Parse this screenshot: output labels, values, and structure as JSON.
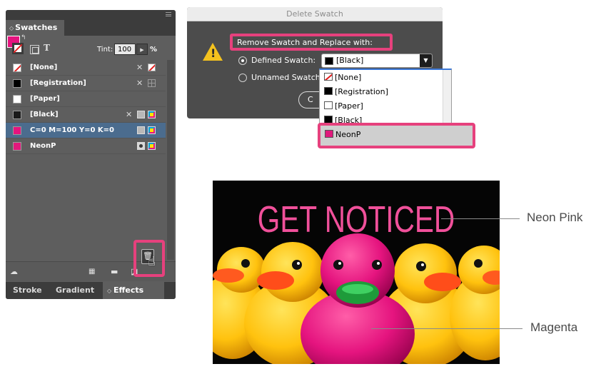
{
  "swatches_panel": {
    "tab_title": "Swatches",
    "tint_label": "Tint:",
    "tint_value": "100",
    "tint_unit": "%",
    "swatches": [
      {
        "name": "[None]",
        "chip": "#ffffff"
      },
      {
        "name": "[Registration]",
        "chip": "#000000"
      },
      {
        "name": "[Paper]",
        "chip": "#ffffff"
      },
      {
        "name": "[Black]",
        "chip": "#1a1a1a"
      },
      {
        "name": "C=0 M=100 Y=0 K=0",
        "chip": "#e5147f",
        "selected": true
      },
      {
        "name": "NeonP",
        "chip": "#e0197c"
      }
    ],
    "bottom_tabs": [
      "Stroke",
      "Gradient",
      "Effects"
    ],
    "icons": {
      "trash": "trash-icon",
      "cursor": "hand-cursor-icon",
      "cloud": "cloud-icon",
      "new_group": "new-color-group-icon",
      "folder": "folder-icon",
      "new_swatch": "new-swatch-icon"
    }
  },
  "dialog": {
    "title": "Delete Swatch",
    "replace_label": "Remove Swatch and Replace with:",
    "option_defined": "Defined Swatch:",
    "option_unnamed": "Unnamed Swatch",
    "selected_swatch": "[Black]",
    "button_partial": "C",
    "dropdown_items": [
      "[None]",
      "[Registration]",
      "[Paper]",
      "[Black]"
    ],
    "dropdown_highlight": "NeonP"
  },
  "image": {
    "headline": "GET NOTICED",
    "callout_top": "Neon Pink",
    "callout_bottom": "Magenta"
  },
  "colors": {
    "highlight": "#e6417d",
    "magenta": "#e5147f",
    "neon_pink": "#f0509a",
    "duck_yellow": "#ffc20e"
  }
}
